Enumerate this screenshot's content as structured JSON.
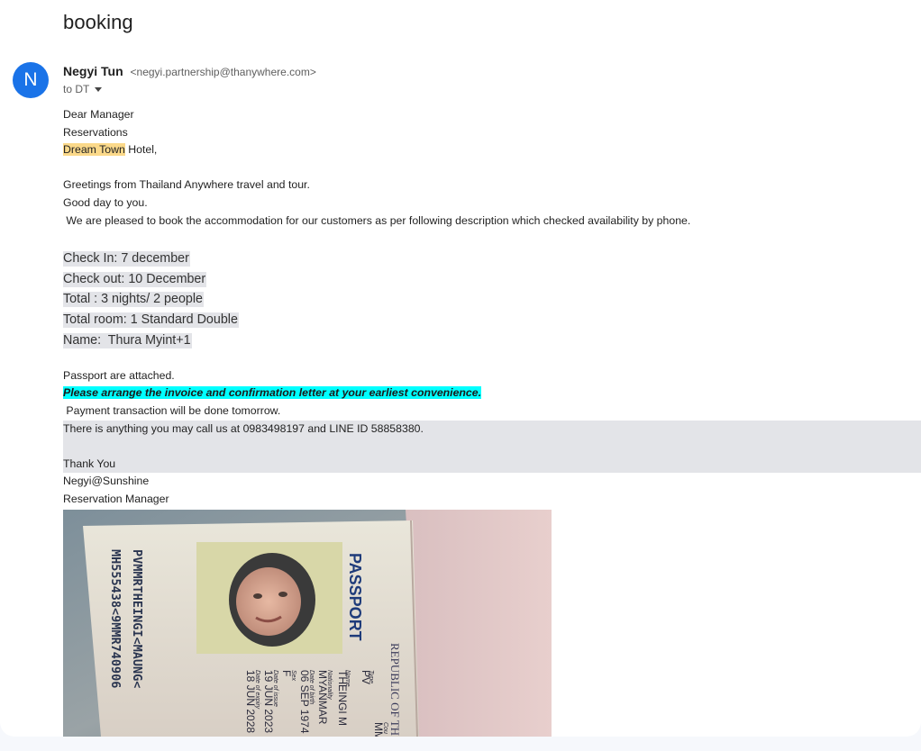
{
  "subject": "booking",
  "sender": {
    "initial": "N",
    "name": "Negyi Tun",
    "email": "<negyi.partnership@thanywhere.com>",
    "to_label": "to DT"
  },
  "body": {
    "salutation": [
      "Dear Manager",
      "Reservations"
    ],
    "hotel_highlight": "Dream Town",
    "hotel_rest": " Hotel,",
    "greeting_lines": [
      "Greetings from Thailand Anywhere travel and tour.",
      "Good day to you.",
      " We are pleased to book the accommodation for our customers as per following description which checked availability by phone."
    ],
    "booking_details": [
      "Check In: 7 december",
      "Check out: 10 December",
      "Total : 3 nights/ 2 people",
      "Total room: 1 Standard Double",
      "Name:  Thura Myint+1"
    ],
    "passport_note": "Passport are attached.",
    "request_highlight": "Please arrange the invoice and confirmation letter at your earliest convenience.",
    "payment_note": " Payment transaction will be done tomorrow.",
    "contact_line": "There is anything you may call us at 0983498197 and LINE ID 58858380.",
    "closing": "Thank You",
    "signature": [
      "Negyi@Sunshine",
      "Reservation Manager"
    ]
  },
  "passport_image": {
    "title": "PASSPORT",
    "issuer": "REPUBLIC OF TH",
    "mrz": [
      "PVMMRTHEINGI<MAUNG<",
      "MH555438<9MMR740906"
    ],
    "field_labels": [
      "Type",
      "Name",
      "Nationality",
      "Date of birth",
      "Sex",
      "Date of issue",
      "Date of expiry"
    ],
    "field_values": [
      "PV",
      "THEINGI M",
      "MYANMAR",
      "06 SEP 1974",
      "F",
      "19 JUN 2023",
      "18 JUN 2028"
    ],
    "country_code_label": "Cou",
    "country_code": "MM"
  }
}
